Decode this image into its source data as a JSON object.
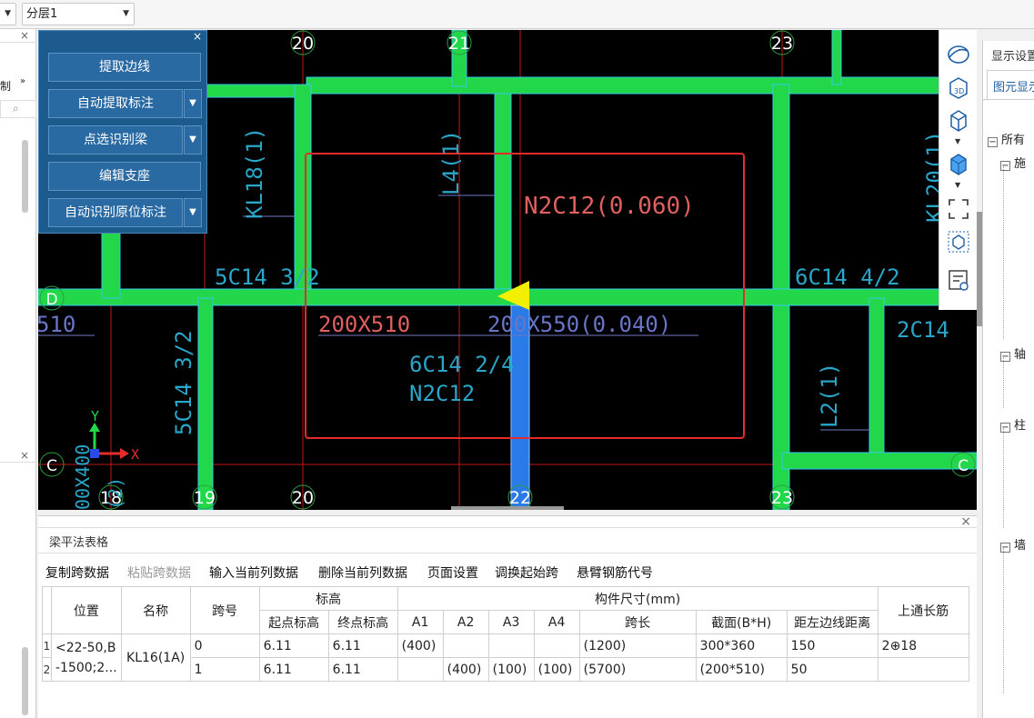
{
  "topbar": {
    "layer_combo": "分层1"
  },
  "toolbox": {
    "buttons": [
      "提取边线",
      "自动提取标注",
      "点选识别梁",
      "编辑支座",
      "自动识别原位标注"
    ]
  },
  "canvas": {
    "axis_top": [
      "20",
      "21",
      "23"
    ],
    "axis_bottom": [
      "18",
      "19",
      "20",
      "22",
      "23"
    ],
    "axis_left": [
      "D",
      "C"
    ],
    "axis_right": [
      "C"
    ],
    "labels": {
      "kl18": "KL18(1)",
      "l4": "L4(1)",
      "kl20": "KL20(1)",
      "n2c12_top": "N2C12(0.060)",
      "c14_32_top": "5C14 3/2",
      "c14_42": "6C14 4/2",
      "b200x510": "200X510",
      "b200x550": "200X550(0.040)",
      "left_510": "510",
      "c14_24": "6C14 2/4",
      "n2c12": "N2C12",
      "c14_32_left": "5C14 3/2",
      "l2": "L2(1)",
      "c14_right": "2C14",
      "vert_left": "00X400",
      "vert_left2": "(2)"
    },
    "axes_x": "X",
    "axes_y": "Y"
  },
  "rightpanel": {
    "title": "显示设置",
    "tab": "图元显示",
    "tree": [
      "所有",
      "施",
      "轴",
      "柱",
      "墙"
    ]
  },
  "bottom": {
    "title": "梁平法表格",
    "tools": [
      "复制跨数据",
      "粘贴跨数据",
      "输入当前列数据",
      "删除当前列数据",
      "页面设置",
      "调换起始跨",
      "悬臂钢筋代号"
    ],
    "headers": {
      "position": "位置",
      "name": "名称",
      "span": "跨号",
      "elevation": "标高",
      "start_elev": "起点标高",
      "end_elev": "终点标高",
      "dims": "构件尺寸(mm)",
      "a1": "A1",
      "a2": "A2",
      "a3": "A3",
      "a4": "A4",
      "span_len": "跨长",
      "section": "截面(B*H)",
      "offset": "距左边线距离",
      "top_bar": "上通长筋"
    },
    "rows": [
      {
        "num": "1",
        "position": "<22-50,B",
        "name": "KL16(1A)",
        "span": "0",
        "start": "6.11",
        "end": "6.11",
        "a1": "(400)",
        "a2": "",
        "a3": "",
        "a4": "",
        "len": "(1200)",
        "section": "300*360",
        "offset": "150",
        "top_bar": "2⊕18"
      },
      {
        "num": "2",
        "position": "-1500;2...",
        "name": "",
        "span": "1",
        "start": "6.11",
        "end": "6.11",
        "a1": "",
        "a2": "(400)",
        "a3": "(100)",
        "a4": "(100)",
        "len": "(5700)",
        "section": "(200*510)",
        "offset": "50",
        "top_bar": ""
      }
    ]
  }
}
